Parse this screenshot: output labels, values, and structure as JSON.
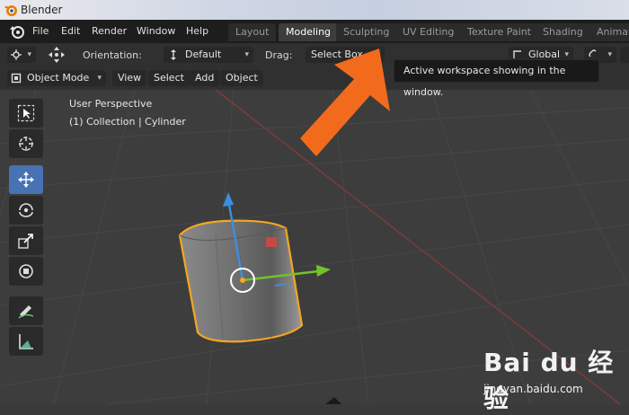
{
  "window": {
    "title": "Blender"
  },
  "menu": [
    "File",
    "Edit",
    "Render",
    "Window",
    "Help"
  ],
  "workspaces": [
    "Layout",
    "Modeling",
    "Sculpting",
    "UV Editing",
    "Texture Paint",
    "Shading",
    "Animati"
  ],
  "active_workspace": "Modeling",
  "header": {
    "orientation_label": "Orientation:",
    "orientation_value": "Default",
    "drag_label": "Drag:",
    "drag_value": "Select Box",
    "global_value": "Global"
  },
  "mode": {
    "value": "Object Mode",
    "menus": [
      "View",
      "Select",
      "Add",
      "Object"
    ]
  },
  "viewport": {
    "perspective": "User Perspective",
    "collection": "(1) Collection | Cylinder"
  },
  "tooltip": {
    "text": "Active workspace showing in the window."
  },
  "tools": [
    "select-box",
    "cursor",
    "move",
    "rotate",
    "scale",
    "transform",
    "annotate",
    "measure"
  ],
  "active_tool": "move",
  "colors": {
    "accent": "#4772b3",
    "arrow": "#f26b1d",
    "selection_outline": "#f5a623",
    "x_axis": "#d8453f",
    "y_axis": "#74c22b",
    "z_axis": "#3d8ee0"
  },
  "watermark": {
    "brand": "Bai du 经验",
    "url": "jingyan.baidu.com"
  }
}
